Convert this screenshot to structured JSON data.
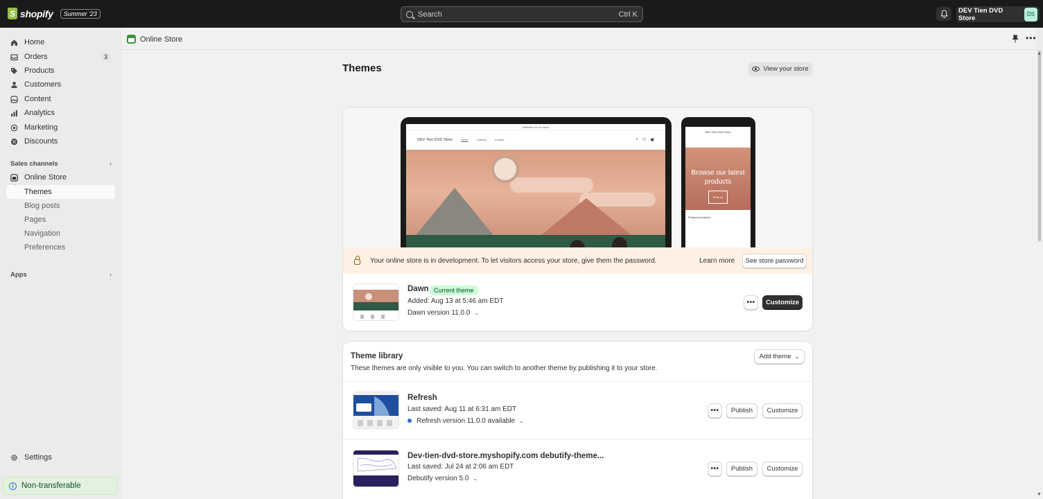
{
  "topbar": {
    "logo_letter": "S",
    "logo_text": "shopify",
    "edition": "Summer '23",
    "search_placeholder": "Search",
    "search_shortcut": "Ctrl K",
    "store_name": "DEV Tien DVD Store",
    "avatar_initials": "DS"
  },
  "sidebar": {
    "items": [
      {
        "label": "Home",
        "icon": "home-icon"
      },
      {
        "label": "Orders",
        "icon": "orders-icon",
        "badge": "3"
      },
      {
        "label": "Products",
        "icon": "tag-icon"
      },
      {
        "label": "Customers",
        "icon": "person-icon"
      },
      {
        "label": "Content",
        "icon": "content-icon"
      },
      {
        "label": "Analytics",
        "icon": "chart-icon"
      },
      {
        "label": "Marketing",
        "icon": "target-icon"
      },
      {
        "label": "Discounts",
        "icon": "discount-icon"
      }
    ],
    "sales_channels_label": "Sales channels",
    "online_store_label": "Online Store",
    "sub_items": [
      "Themes",
      "Blog posts",
      "Pages",
      "Navigation",
      "Preferences"
    ],
    "apps_label": "Apps",
    "settings_label": "Settings",
    "non_transferable": "Non-transferable"
  },
  "header": {
    "breadcrumb": "Online Store"
  },
  "page": {
    "title": "Themes",
    "view_store": "View your store"
  },
  "current_theme": {
    "preview": {
      "announcement": "Welcome to our store",
      "store_name": "DEV Tien DVD Store",
      "links": [
        "Home",
        "Catalog",
        "Contact"
      ],
      "mobile_store_name": "DEV Tien DVD Store",
      "mobile_hero": "Browse our latest products",
      "mobile_button": "Shop all",
      "featured": "Featured products"
    },
    "warning": "Your online store is in development. To let visitors access your store, give them the password.",
    "learn_more": "Learn more",
    "see_password": "See store password",
    "name": "Dawn",
    "badge": "Current theme",
    "added": "Added: Aug 13 at 5:46 am EDT",
    "version": "Dawn version 11.0.0",
    "customize": "Customize"
  },
  "library": {
    "title": "Theme library",
    "subtitle": "These themes are only visible to you. You can switch to another theme by publishing it to your store.",
    "add_theme": "Add theme",
    "themes": [
      {
        "name": "Refresh",
        "saved": "Last saved: Aug 11 at 6:31 am EDT",
        "version": "Refresh version 11.0.0 available",
        "publish": "Publish",
        "customize": "Customize"
      },
      {
        "name": "Dev-tien-dvd-store.myshopify.com debutify-theme...",
        "saved": "Last saved: Jul 24 at 2:06 am EDT",
        "version": "Debutify version 5.0",
        "publish": "Publish",
        "customize": "Customize"
      }
    ]
  },
  "colors": {
    "topbar": "#1a1a1a",
    "sidebar": "#ebebeb",
    "accent_green": "#95bf47",
    "current_badge": "#cdfed4",
    "warning_bg": "#fff1e3"
  }
}
